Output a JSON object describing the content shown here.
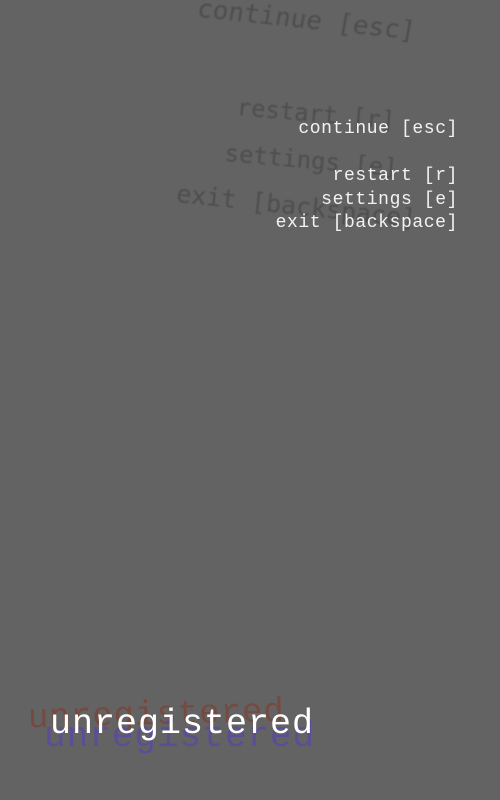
{
  "pause_menu": {
    "continue_label": "continue [esc]",
    "restart_label": "restart [r]",
    "settings_label": "settings [e]",
    "exit_label": "exit [backspace]"
  },
  "ghost_menu": {
    "continue_label": "continue [esc]",
    "restart_label": "restart [r]",
    "settings_label": "settings [e]",
    "exit_label": "exit [backspace]"
  },
  "watermark": {
    "text": "unregistered"
  },
  "colors": {
    "background": "#636363",
    "menu_text": "#f2f2f2",
    "ghost_text": "#474747",
    "watermark_red": "#7a4438",
    "watermark_blue": "#5a4aa0"
  }
}
